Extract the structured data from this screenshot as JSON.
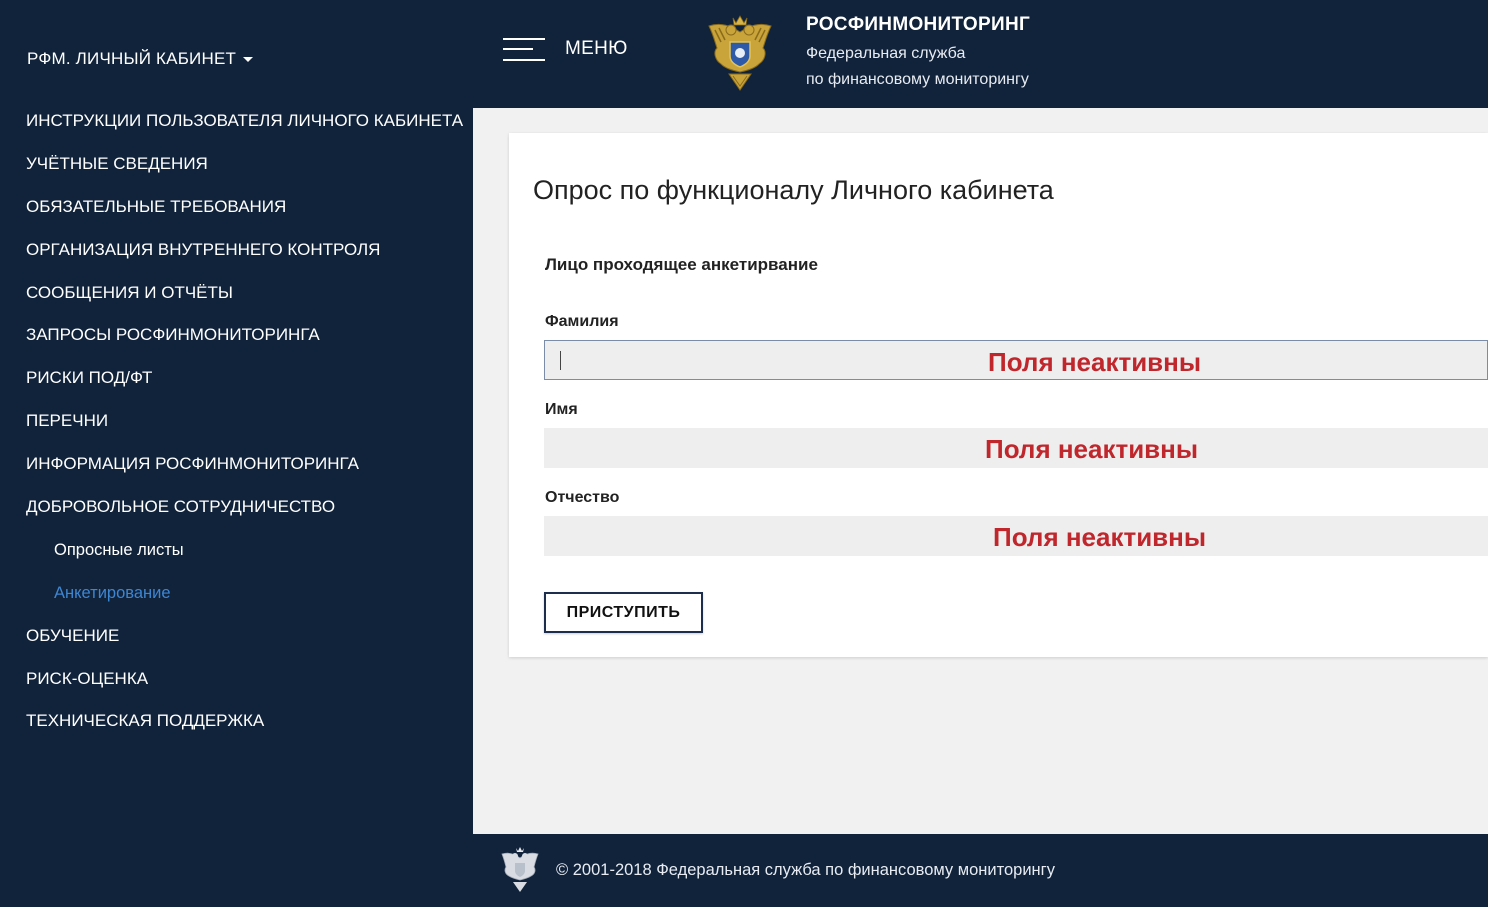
{
  "sidebar": {
    "brand": "РФМ. ЛИЧНЫЙ КАБИНЕТ",
    "items": [
      {
        "label": "ИНСТРУКЦИИ ПОЛЬЗОВАТЕЛЯ ЛИЧНОГО КАБИНЕТА"
      },
      {
        "label": "УЧЁТНЫЕ СВЕДЕНИЯ"
      },
      {
        "label": "ОБЯЗАТЕЛЬНЫЕ ТРЕБОВАНИЯ"
      },
      {
        "label": "ОРГАНИЗАЦИЯ ВНУТРЕННЕГО КОНТРОЛЯ"
      },
      {
        "label": "СООБЩЕНИЯ И ОТЧЁТЫ"
      },
      {
        "label": "ЗАПРОСЫ РОСФИНМОНИТОРИНГА"
      },
      {
        "label": "РИСКИ ПОД/ФТ"
      },
      {
        "label": "ПЕРЕЧНИ"
      },
      {
        "label": "ИНФОРМАЦИЯ РОСФИНМОНИТОРИНГА"
      },
      {
        "label": "ДОБРОВОЛЬНОЕ СОТРУДНИЧЕСТВО"
      },
      {
        "label": "Опросные листы"
      },
      {
        "label": "Анкетирование"
      },
      {
        "label": "ОБУЧЕНИЕ"
      },
      {
        "label": "РИСК-ОЦЕНКА"
      },
      {
        "label": "ТЕХНИЧЕСКАЯ ПОДДЕРЖКА"
      }
    ]
  },
  "header": {
    "menu_label": "МЕНЮ",
    "logo_icon": "emblem-icon",
    "org_title": "РОСФИНМОНИТОРИНГ",
    "org_subtitle_line1": "Федеральная служба",
    "org_subtitle_line2": "по финансовому мониторингу"
  },
  "main": {
    "title": "Опрос по функционалу Личного кабинета",
    "section_title": "Лицо проходящее анкетирвание",
    "fields": [
      {
        "label": "Фамилия",
        "value": "",
        "overlay": "Поля неактивны"
      },
      {
        "label": "Имя",
        "value": "",
        "overlay": "Поля неактивны"
      },
      {
        "label": "Отчество",
        "value": "",
        "overlay": "Поля неактивны"
      }
    ],
    "start_button": "ПРИСТУПИТЬ"
  },
  "footer": {
    "text": "© 2001-2018 Федеральная служба по финансовому мониторингу"
  },
  "colors": {
    "navy": "#11233b",
    "active_link": "#3d86d3",
    "overlay_red": "#c0272d"
  }
}
